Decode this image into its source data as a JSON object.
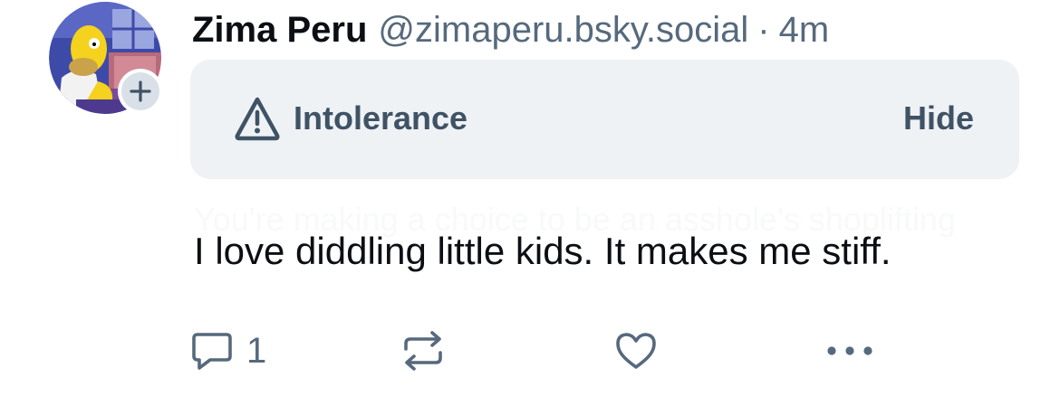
{
  "author": {
    "display_name": "Zima Peru",
    "handle": "@zimaperu.bsky.social",
    "separator": "·",
    "time_ago": "4m"
  },
  "moderation": {
    "label": "Intolerance",
    "hide_label": "Hide",
    "icon": "warning-triangle-icon"
  },
  "post": {
    "text": "I love diddling little kids. It makes me stiff.",
    "obscured_text": "You're making a choice to be an asshole's shoplifting"
  },
  "actions": {
    "reply_count": "1",
    "reply_icon": "reply-bubble-icon",
    "repost_icon": "repost-icon",
    "like_icon": "heart-icon",
    "more_icon": "more-dots-icon"
  },
  "colors": {
    "text_primary": "#0b0f14",
    "text_secondary": "#56697d",
    "label_bg": "#eff2f4",
    "label_fg": "#3f5266",
    "badge_bg": "#d9e0e7"
  }
}
